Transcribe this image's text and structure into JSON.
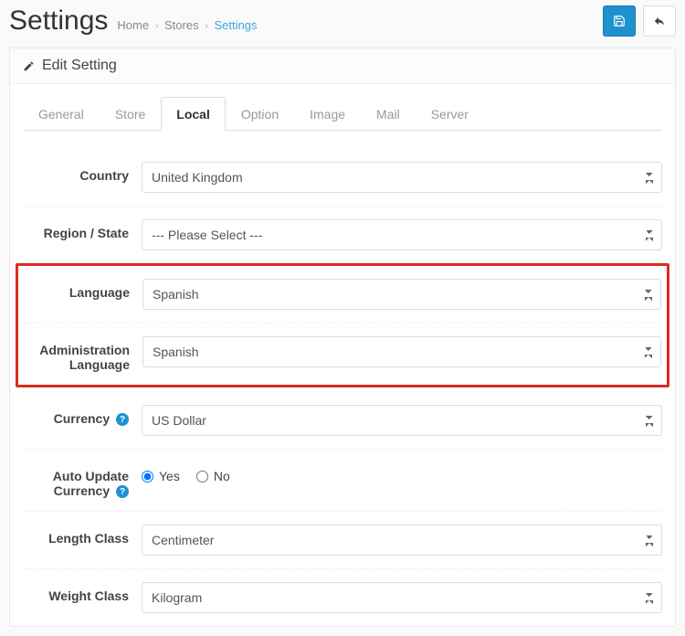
{
  "header": {
    "title": "Settings",
    "breadcrumbs": [
      "Home",
      "Stores",
      "Settings"
    ]
  },
  "panel": {
    "title": "Edit Setting"
  },
  "tabs": [
    {
      "label": "General",
      "active": false
    },
    {
      "label": "Store",
      "active": false
    },
    {
      "label": "Local",
      "active": true
    },
    {
      "label": "Option",
      "active": false
    },
    {
      "label": "Image",
      "active": false
    },
    {
      "label": "Mail",
      "active": false
    },
    {
      "label": "Server",
      "active": false
    }
  ],
  "form": {
    "country": {
      "label": "Country",
      "value": "United Kingdom"
    },
    "region_state": {
      "label": "Region / State",
      "value": "--- Please Select ---"
    },
    "language": {
      "label": "Language",
      "value": "Spanish"
    },
    "admin_language": {
      "label": "Administration Language",
      "value": "Spanish"
    },
    "currency": {
      "label": "Currency",
      "value": "US Dollar"
    },
    "auto_update_currency": {
      "label": "Auto Update Currency",
      "options": {
        "yes": "Yes",
        "no": "No"
      },
      "selected": "yes"
    },
    "length_class": {
      "label": "Length Class",
      "value": "Centimeter"
    },
    "weight_class": {
      "label": "Weight Class",
      "value": "Kilogram"
    }
  },
  "icons": {
    "save": "save-icon",
    "back": "reply-icon",
    "edit": "pencil-icon",
    "help": "?"
  }
}
